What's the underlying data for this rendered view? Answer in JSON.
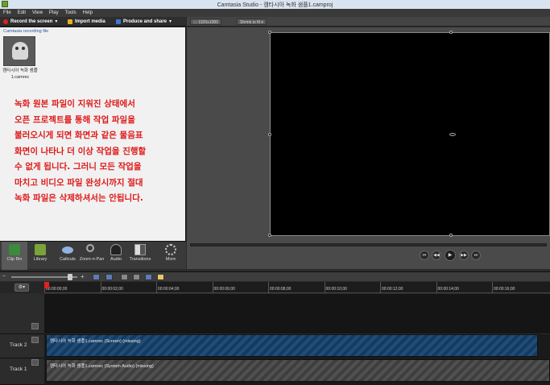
{
  "window": {
    "title": "Camtasia Studio - 캠타시아 녹화 샘플1.camproj"
  },
  "menu": [
    "File",
    "Edit",
    "View",
    "Play",
    "Tools",
    "Help"
  ],
  "toolbar": {
    "record_label": "Record the screen",
    "import_label": "Import media",
    "produce_label": "Produce and share"
  },
  "clipbin": {
    "header": "Camtasia recording file",
    "item_label": "캠타시아 녹화 샘플1.camrec",
    "note": "녹화 원본 파일이 지워진 상태에서\n오픈 프로젝트를 통해 작업 파일을\n불러오시게 되면 화면과 같은 물음표\n화면이 나타나 더 이상 작업을 진행할\n수 없게 됩니다. 그러니 모든 작업을\n마치고 비디오 파일 완성시까지 절대\n녹화 파일은 삭제하셔서는 안됩니다."
  },
  "tabs": [
    "Clip Bin",
    "Library",
    "Callouts",
    "Zoom-n-Pan",
    "Audio",
    "Transitions",
    "More"
  ],
  "preview": {
    "resolution": "1920x1080",
    "fit": "Shrink to fit"
  },
  "ruler": [
    "00:00:00;00",
    "00:00:02;00",
    "00:00:04;00",
    "00:00:06;00",
    "00:00:08;00",
    "00:00:10;00",
    "00:00:12;00",
    "00:00:14;00",
    "00:00:16;00"
  ],
  "tracks": [
    {
      "name": "Track 2",
      "clip": "캠타시아 녹화 샘플1.camrec (Screen) (missing)"
    },
    {
      "name": "Track 1",
      "clip": "캠타시아 녹화 샘플1.camrec (System Audio) (missing)"
    }
  ]
}
